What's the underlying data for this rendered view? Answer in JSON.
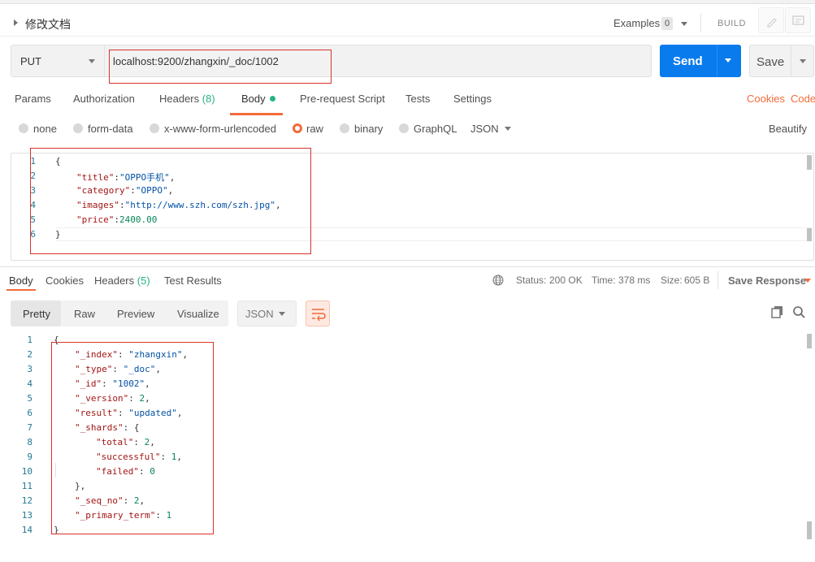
{
  "header": {
    "request_name": "修改文档",
    "examples_label": "Examples",
    "examples_count": "0",
    "build_label": "BUILD"
  },
  "request": {
    "method": "PUT",
    "url": "localhost:9200/zhangxin/_doc/1002",
    "send_label": "Send",
    "save_label": "Save"
  },
  "request_tabs": [
    {
      "label": "Params"
    },
    {
      "label": "Authorization"
    },
    {
      "label": "Headers",
      "count": "(8)"
    },
    {
      "label": "Body"
    },
    {
      "label": "Pre-request Script"
    },
    {
      "label": "Tests"
    },
    {
      "label": "Settings"
    }
  ],
  "request_links": {
    "cookies": "Cookies",
    "code": "Code"
  },
  "body_types": [
    "none",
    "form-data",
    "x-www-form-urlencoded",
    "raw",
    "binary",
    "GraphQL"
  ],
  "body_format": "JSON",
  "beautify_label": "Beautify",
  "request_body": {
    "line_numbers": [
      "1",
      "2",
      "3",
      "4",
      "5",
      "6"
    ],
    "lines": [
      {
        "k": "",
        "v": "{"
      },
      {
        "k": "\"title\"",
        "v": "\"OPPO手机\"",
        "t": ","
      },
      {
        "k": "\"category\"",
        "v": "\"OPPO\"",
        "t": ","
      },
      {
        "k": "\"images\"",
        "v": "\"http://www.szh.com/szh.jpg\"",
        "t": ","
      },
      {
        "k": "\"price\"",
        "v": "2400.00",
        "t": ""
      },
      {
        "k": "",
        "v": "}"
      }
    ]
  },
  "response_tabs": [
    {
      "label": "Body"
    },
    {
      "label": "Cookies"
    },
    {
      "label": "Headers",
      "count": "(5)"
    },
    {
      "label": "Test Results"
    }
  ],
  "response_status": {
    "status_label": "Status:",
    "status_value": "200 OK",
    "time_label": "Time:",
    "time_value": "378 ms",
    "size_label": "Size:",
    "size_value": "605 B",
    "save_response": "Save Response"
  },
  "view_modes": [
    "Pretty",
    "Raw",
    "Preview",
    "Visualize"
  ],
  "response_format": "JSON",
  "response_body": {
    "line_numbers": [
      "1",
      "2",
      "3",
      "4",
      "5",
      "6",
      "7",
      "8",
      "9",
      "10",
      "11",
      "12",
      "13",
      "14"
    ],
    "lines": [
      {
        "i": 0,
        "k": "",
        "v": "{"
      },
      {
        "i": 1,
        "k": "\"_index\"",
        "v": "\"zhangxin\"",
        "t": ","
      },
      {
        "i": 1,
        "k": "\"_type\"",
        "v": "\"_doc\"",
        "t": ","
      },
      {
        "i": 1,
        "k": "\"_id\"",
        "v": "\"1002\"",
        "t": ","
      },
      {
        "i": 1,
        "k": "\"_version\"",
        "v": "2",
        "t": ","
      },
      {
        "i": 1,
        "k": "\"result\"",
        "v": "\"updated\"",
        "t": ","
      },
      {
        "i": 1,
        "k": "\"_shards\"",
        "v": "{",
        "t": ""
      },
      {
        "i": 2,
        "k": "\"total\"",
        "v": "2",
        "t": ","
      },
      {
        "i": 2,
        "k": "\"successful\"",
        "v": "1",
        "t": ","
      },
      {
        "i": 2,
        "k": "\"failed\"",
        "v": "0",
        "t": ""
      },
      {
        "i": 1,
        "k": "",
        "v": "},"
      },
      {
        "i": 1,
        "k": "\"_seq_no\"",
        "v": "2",
        "t": ","
      },
      {
        "i": 1,
        "k": "\"_primary_term\"",
        "v": "1",
        "t": ""
      },
      {
        "i": 0,
        "k": "",
        "v": "}"
      }
    ]
  },
  "colors": {
    "accent": "#f26b3a",
    "send": "#097bed",
    "success": "#26b47f",
    "annotation": "#d9322b"
  },
  "icons": [
    "pencil-icon",
    "comment-icon",
    "globe-icon",
    "wrap-lines-icon",
    "copy-icon",
    "search-icon"
  ]
}
